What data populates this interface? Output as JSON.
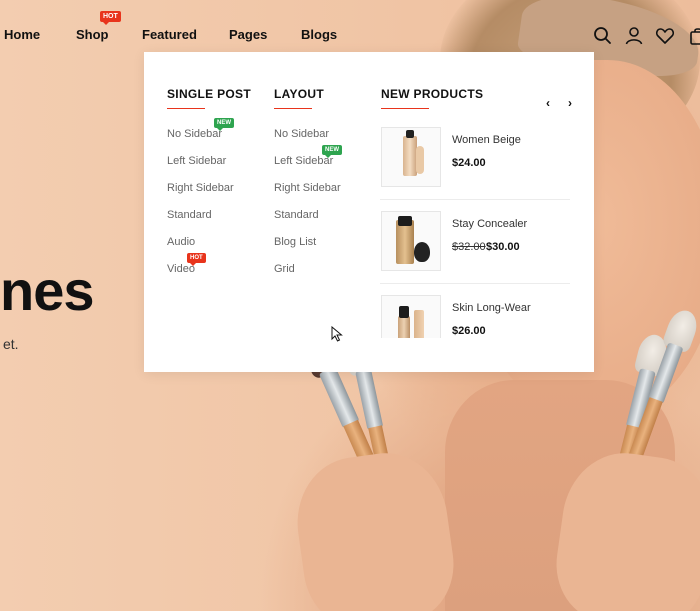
{
  "nav": {
    "items": [
      {
        "label": "Home"
      },
      {
        "label": "Shop",
        "badge": "HOT"
      },
      {
        "label": "Featured"
      },
      {
        "label": "Pages"
      },
      {
        "label": "Blogs"
      }
    ],
    "icons": [
      "search-icon",
      "user-icon",
      "heart-icon",
      "bag-icon"
    ]
  },
  "hero": {
    "title_fragment": "nes",
    "subtitle_fragment": "et."
  },
  "menu": {
    "single_post": {
      "title": "SINGLE POST",
      "links": [
        {
          "label": "No Sidebar",
          "tag": "NEW"
        },
        {
          "label": "Left Sidebar"
        },
        {
          "label": "Right Sidebar"
        },
        {
          "label": "Standard"
        },
        {
          "label": "Audio"
        },
        {
          "label": "Video",
          "tag": "HOT"
        }
      ]
    },
    "layout": {
      "title": "LAYOUT",
      "links": [
        {
          "label": "No Sidebar"
        },
        {
          "label": "Left Sidebar",
          "tag": "NEW"
        },
        {
          "label": "Right Sidebar"
        },
        {
          "label": "Standard"
        },
        {
          "label": "Blog List"
        },
        {
          "label": "Grid"
        }
      ]
    },
    "new_products": {
      "title": "NEW PRODUCTS",
      "prev": "‹",
      "next": "›",
      "items": [
        {
          "name": "Women Beige",
          "price": "$24.00"
        },
        {
          "name": "Stay Concealer",
          "old_price": "$32.00",
          "price": "$30.00"
        },
        {
          "name": "Skin Long-Wear",
          "price": "$26.00"
        }
      ]
    }
  },
  "colors": {
    "accent": "#e8341c",
    "new_tag": "#2ea44f",
    "hot_tag": "#e8341c"
  }
}
